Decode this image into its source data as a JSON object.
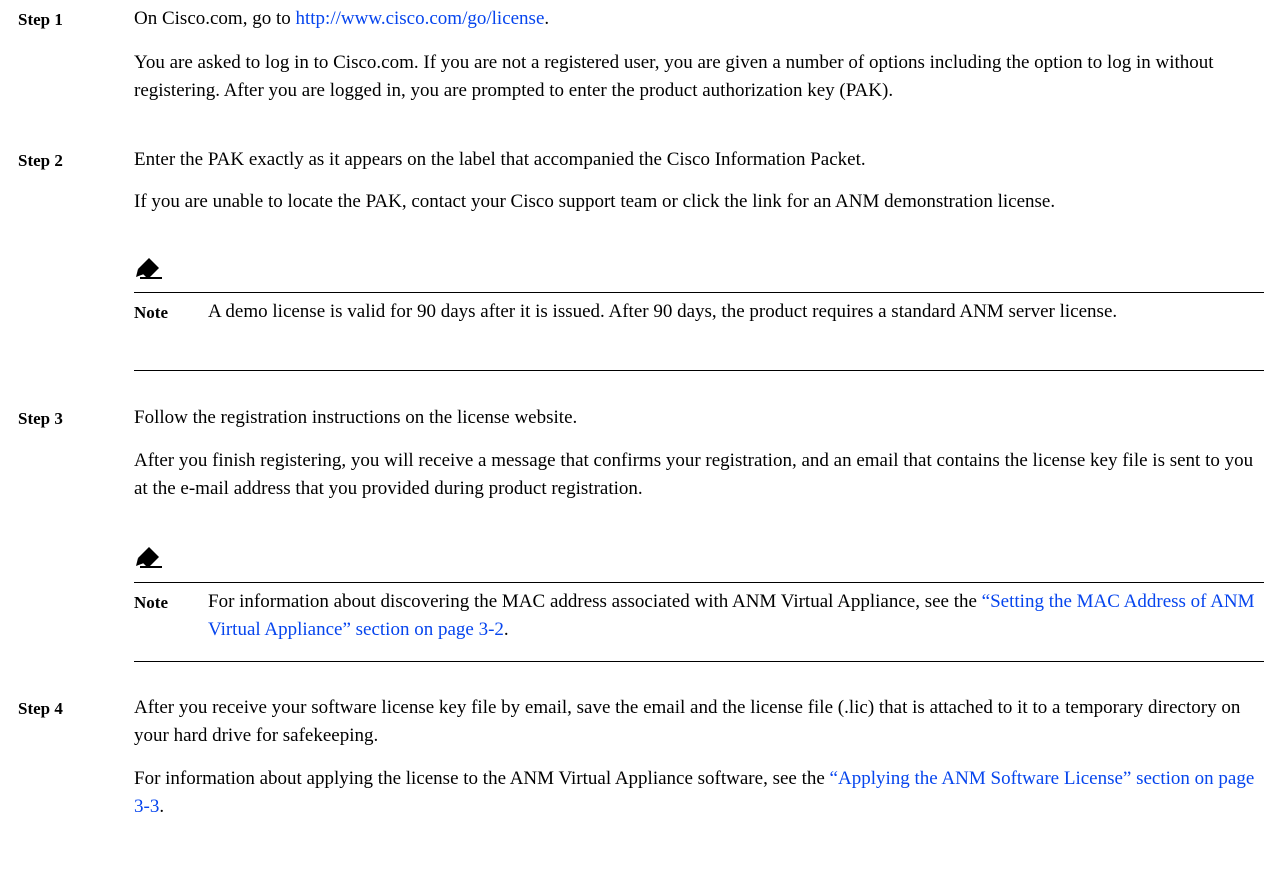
{
  "steps": [
    {
      "label": "Step 1",
      "main_prefix": "On Cisco.com, go to ",
      "main_link": "http://www.cisco.com/go/license",
      "main_suffix": ".",
      "detail": "You are asked to log in to Cisco.com. If you are not a registered user, you are given a number of options including the option to log in without registering. After you are logged in, you are prompted to enter the product authorization key (PAK)."
    },
    {
      "label": "Step 2",
      "main": "Enter the PAK exactly as it appears on the label that accompanied the Cisco Information Packet.",
      "detail": "If you are unable to locate the PAK, contact your Cisco support team or click the link for an ANM demonstration license.",
      "note_label": "Note",
      "note": "A demo license is valid for 90 days after it is issued. After 90 days, the product requires a standard ANM server license."
    },
    {
      "label": "Step 3",
      "main": "Follow the registration instructions on the license website.",
      "detail": "After you finish registering, you will receive a message that confirms your registration, and an email that contains the license key file is sent to you at the e-mail address that you provided during product registration.",
      "note_label": "Note",
      "note_prefix": "For information about discovering the MAC address associated with ANM Virtual Appliance, see the ",
      "note_link": "“Setting the MAC Address of ANM Virtual Appliance” section on page 3-2",
      "note_suffix": "."
    },
    {
      "label": "Step 4",
      "main": "After you receive your software license key file by email, save the email and the license file (.lic) that is attached to it to a temporary directory on your hard drive for safekeeping.",
      "detail_prefix": "For information about applying the license to the ANM Virtual Appliance software, see the ",
      "detail_link": "“Applying the ANM Software License” section on page 3-3",
      "detail_suffix": "."
    }
  ]
}
